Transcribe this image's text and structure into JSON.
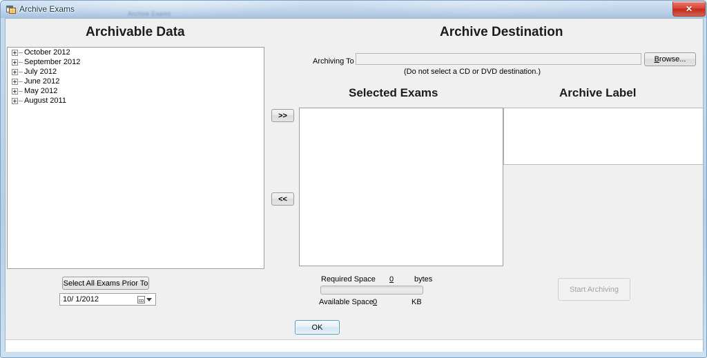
{
  "window": {
    "title": "Archive Exams",
    "ghost_title": "Archive Exams",
    "app_icon": "application-window-icon",
    "close_label": "✕"
  },
  "headings": {
    "archivable_data": "Archivable Data",
    "archive_destination": "Archive Destination",
    "selected_exams": "Selected Exams",
    "archive_label": "Archive Label"
  },
  "tree": {
    "items": [
      {
        "label": "October 2012"
      },
      {
        "label": "September 2012"
      },
      {
        "label": "July 2012"
      },
      {
        "label": "June 2012"
      },
      {
        "label": "May 2012"
      },
      {
        "label": "August 2011"
      }
    ]
  },
  "left_panel": {
    "select_all_button": "Select All Exams Prior To",
    "date_value": "10/  1/2012",
    "calendar_icon": "calendar-icon",
    "dropdown_icon": "chevron-down-icon"
  },
  "transfer": {
    "add_label": ">>",
    "remove_label": "<<"
  },
  "destination": {
    "archiving_to_label": "Archiving To",
    "archiving_to_value": "",
    "archiving_to_placeholder": "",
    "browse_button_prefix": "",
    "browse_button_accel": "B",
    "browse_button_suffix": "rowse...",
    "hint": "(Do not select a CD or DVD destination.)"
  },
  "selected_exams": {
    "items": []
  },
  "archive_label": {
    "value": ""
  },
  "space": {
    "required_label": "Required Space",
    "required_value": "0",
    "required_units": "bytes",
    "progress_percent": 0,
    "available_label": "Available Space",
    "available_value": "0",
    "available_units": "KB"
  },
  "actions": {
    "start_archiving": "Start Archiving",
    "ok": "OK"
  },
  "colors": {
    "accent_blue": "#4e9ec6",
    "close_red": "#c32a1d",
    "client_bg": "#f0f0f0",
    "frame_blue": "#b4cee6"
  }
}
